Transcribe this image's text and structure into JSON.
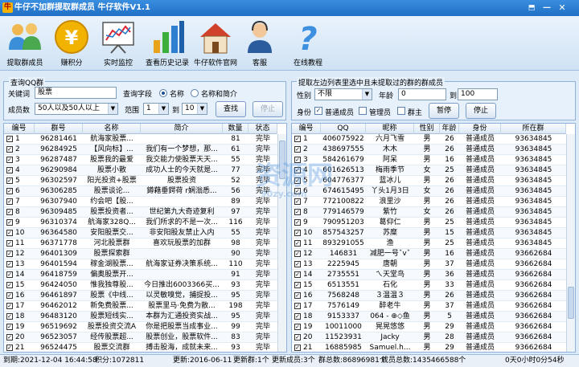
{
  "window": {
    "title": "牛仔不加群提取群成员 牛仔软件V1.1"
  },
  "toolbar": [
    {
      "icon": "people-icon",
      "label": "提取群成员"
    },
    {
      "icon": "coin-icon",
      "label": "赚积分"
    },
    {
      "icon": "monitor-chart-icon",
      "label": "实时监控"
    },
    {
      "icon": "bar-chart-icon",
      "label": "查看历史记录"
    },
    {
      "icon": "house-icon",
      "label": "牛仔软件官网"
    },
    {
      "icon": "support-person-icon",
      "label": "客服"
    },
    {
      "icon": "help-question-icon",
      "label": "在线教程"
    }
  ],
  "query_panel": {
    "title": "查询QQ群",
    "keyword_label": "关键词",
    "keyword_value": "股票",
    "field_label": "查询字段",
    "opt_name": "名称",
    "opt_name_intro": "名称和简介",
    "members_label": "成员数",
    "members_value": "50人以及50人以上",
    "range_label": "范围",
    "range_from": "1",
    "range_to_label": "到",
    "range_to": "10",
    "search_btn": "查找",
    "stop_btn": "停止"
  },
  "extract_panel": {
    "title": "提取左边列表里选中且未提取过的群的群成员",
    "gender_label": "性别",
    "gender_value": "不限",
    "age_label": "年龄",
    "age_from": "0",
    "age_to_label": "到",
    "age_to": "100",
    "role_label": "身份",
    "role_normal": "普通成员",
    "role_admin": "管理员",
    "role_owner": "群主",
    "pause_btn": "暂停",
    "stop_btn": "停止"
  },
  "group_table": {
    "columns": [
      "编号",
      "群号",
      "名称",
      "简介",
      "数量",
      "状态"
    ],
    "rows": [
      [
        "1",
        "96281461",
        "航海家股票...",
        "",
        "81",
        "完毕"
      ],
      [
        "2",
        "96284925",
        "【风向标】...",
        "我们有一个梦想，那...",
        "61",
        "完毕"
      ],
      [
        "3",
        "96287487",
        "股票我的最爱",
        "我交能力使股票天天...",
        "55",
        "完毕"
      ],
      [
        "4",
        "96290984",
        "股票小散",
        "成功人士的今天就是...",
        "77",
        "完毕"
      ],
      [
        "5",
        "96302597",
        "阳光投资+股票",
        "股票投资",
        "52",
        "完毕"
      ],
      [
        "6",
        "96306285",
        "股票谈论...",
        "鐏藉垂鍔荷 r娴滃悉...",
        "56",
        "完毕"
      ],
      [
        "7",
        "96307940",
        "约会吧【股...",
        "",
        "89",
        "完毕"
      ],
      [
        "8",
        "96309485",
        "股票投资者...",
        "世纪第九大奇迹复利",
        "97",
        "完毕"
      ],
      [
        "9",
        "96310374",
        "航海家328Q...",
        "我们所求的不是一次...",
        "116",
        "完毕"
      ],
      [
        "10",
        "96364580",
        "安阳股票交...",
        "非安阳股友禁止入内",
        "55",
        "完毕"
      ],
      [
        "11",
        "96371778",
        "河北股票群",
        "喜欢玩股票的加群",
        "98",
        "完毕"
      ],
      [
        "12",
        "96401309",
        "股票探索群",
        "",
        "90",
        "完毕"
      ],
      [
        "13",
        "96401594",
        "稼金湖股票...",
        "航海家证券决策系统...",
        "110",
        "完毕"
      ],
      [
        "14",
        "96418759",
        "偏奥股票开...",
        "",
        "91",
        "完毕"
      ],
      [
        "15",
        "96424050",
        "惟我独尊股...",
        "今日推出6003366买...",
        "93",
        "完毕"
      ],
      [
        "16",
        "96461897",
        "股票《中线...",
        "以灵敏嗅觉，捕捉投...",
        "95",
        "完毕"
      ],
      [
        "17",
        "96462012",
        "新免费股票...",
        "股票里马·免费为散...",
        "198",
        "完毕"
      ],
      [
        "18",
        "96483120",
        "股票短线实...",
        "本群为汇通投资实战...",
        "95",
        "完毕"
      ],
      [
        "19",
        "96519692",
        "股票投资交流A",
        "你是把股票当成事业...",
        "99",
        "完毕"
      ],
      [
        "20",
        "96523057",
        "经传股票超...",
        "股票创业，股票软件...",
        "83",
        "完毕"
      ],
      [
        "21",
        "96524475",
        "股票交流群",
        "搏击股海，成就未来...",
        "93",
        "完毕"
      ]
    ]
  },
  "member_table": {
    "columns": [
      "编号",
      "QQ",
      "昵称",
      "性别",
      "年龄",
      "身份",
      "所在群"
    ],
    "rows": [
      [
        "1",
        "406075922",
        "六月飞雪",
        "男",
        "26",
        "普通成员",
        "93634845"
      ],
      [
        "2",
        "438697555",
        "木木",
        "男",
        "26",
        "普通成员",
        "93634845"
      ],
      [
        "3",
        "584261679",
        "阿呆",
        "男",
        "16",
        "普通成员",
        "93634845"
      ],
      [
        "4",
        "601626513",
        "梅雨季节",
        "女",
        "25",
        "普通成员",
        "93634845"
      ],
      [
        "5",
        "604776377",
        "蓝冰儿",
        "男",
        "26",
        "普通成员",
        "93634845"
      ],
      [
        "6",
        "674615495",
        "丫头1月3日",
        "女",
        "26",
        "普通成员",
        "93634845"
      ],
      [
        "7",
        "772100822",
        "浪里沙",
        "男",
        "26",
        "普通成员",
        "93634845"
      ],
      [
        "8",
        "779146579",
        "紫竹",
        "女",
        "26",
        "普通成员",
        "93634845"
      ],
      [
        "9",
        "790951203",
        "葛仰仁",
        "男",
        "25",
        "普通成员",
        "93634845"
      ],
      [
        "10",
        "857543257",
        "苏糜",
        "男",
        "15",
        "普通成员",
        "93634845"
      ],
      [
        "11",
        "893291055",
        "渔",
        "男",
        "25",
        "普通成员",
        "93634845"
      ],
      [
        "12",
        "146831",
        "减肥一号ˇvˇ",
        "男",
        "16",
        "普通成员",
        "93662684"
      ],
      [
        "13",
        "2225945",
        "唐朝",
        "男",
        "37",
        "普通成员",
        "93662684"
      ],
      [
        "14",
        "2735551",
        "ㄟ天堂鸟",
        "男",
        "36",
        "普通成员",
        "93662684"
      ],
      [
        "15",
        "6513551",
        "石化",
        "男",
        "33",
        "普通成员",
        "93662684"
      ],
      [
        "16",
        "7568248",
        "３温温３",
        "男",
        "26",
        "普通成员",
        "93662684"
      ],
      [
        "17",
        "7576149",
        "醉老牛",
        "男",
        "37",
        "普通成员",
        "93662684"
      ],
      [
        "18",
        "9153337",
        "064 - ⊕◇鱼",
        "男",
        "5",
        "普通成员",
        "93662684"
      ],
      [
        "19",
        "10011000",
        "晃晃悠悠",
        "男",
        "29",
        "普通成员",
        "93662684"
      ],
      [
        "20",
        "11523931",
        "Jacky",
        "男",
        "28",
        "普通成员",
        "93662684"
      ],
      [
        "21",
        "16885985",
        "Samuel.h...",
        "男",
        "29",
        "普通成员",
        "93662684"
      ]
    ]
  },
  "status": {
    "expire": "到期:2021-12-04 16:44:58",
    "points": "积分:1072811",
    "updated": "更新:2016-06-11",
    "new_groups": "更新群:1个",
    "new_members": "更新成员:3个",
    "group_total": "群总数:86896981个",
    "member_total": "成员总数:1435466588个",
    "elapsed": "0天0小时0分54秒"
  },
  "watermark": {
    "text": "资源网",
    "url": "90zy.com"
  }
}
